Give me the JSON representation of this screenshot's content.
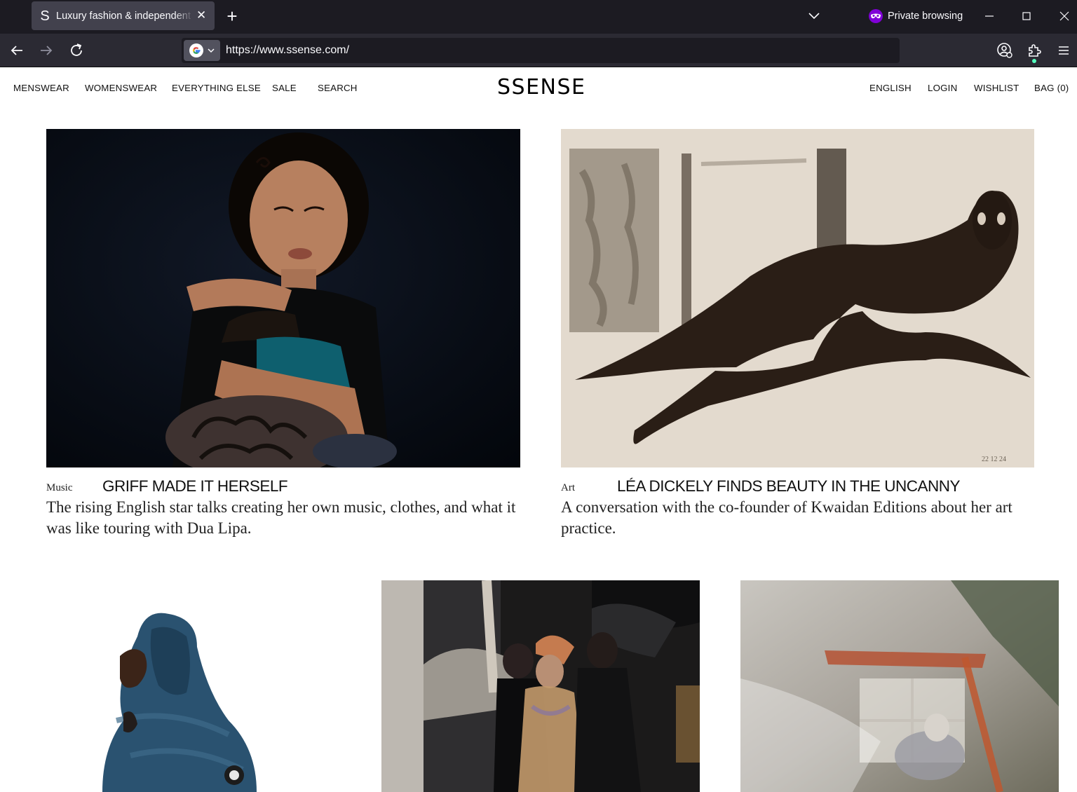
{
  "browser": {
    "tab": {
      "favicon": "S",
      "title": "Luxury fashion & independent designers | SSENSE",
      "close_icon": "close-icon"
    },
    "private_label": "Private browsing",
    "url": "https://www.ssense.com/"
  },
  "site": {
    "logo": "SSENSE",
    "nav_left": [
      "MENSWEAR",
      "WOMENSWEAR",
      "EVERYTHING ELSE",
      "SALE",
      "SEARCH"
    ],
    "nav_right": [
      "ENGLISH",
      "LOGIN",
      "WISHLIST",
      "BAG (0)"
    ]
  },
  "articles": [
    {
      "category": "Music",
      "title": "GRIFF MADE IT HERSELF",
      "description": "The rising English star talks creating her own music, clothes, and what it was like touring with Dua Lipa."
    },
    {
      "category": "Art",
      "title": "LÉA DICKELY FINDS BEAUTY IN THE UNCANNY",
      "description": "A conversation with the co-founder of Kwaidan Editions about her art practice."
    }
  ],
  "artwork_date": "22 12 24",
  "colors": {
    "tabbar_bg": "#1c1b22",
    "toolbar_bg": "#2b2a33",
    "urlbar_bg": "#1c1b22",
    "private_accent": "#8000d7",
    "page_bg": "#ffffff"
  }
}
